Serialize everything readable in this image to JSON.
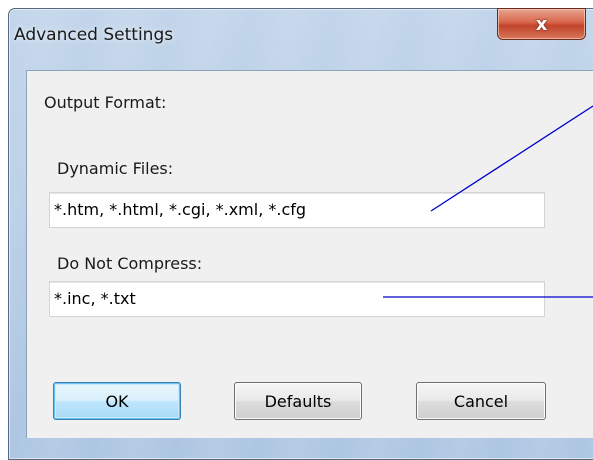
{
  "window": {
    "title": "Advanced Settings",
    "close_glyph": "x"
  },
  "dialog": {
    "output_format_label": "Output Format:",
    "dynamic_files_label": "Dynamic Files:",
    "dynamic_files_value": "*.htm, *.html, *.cgi, *.xml, *.cfg",
    "do_not_compress_label": "Do Not Compress:",
    "do_not_compress_value": "*.inc, *.txt"
  },
  "buttons": {
    "ok": "OK",
    "defaults": "Defaults",
    "cancel": "Cancel"
  },
  "colors": {
    "annotation_line": "#0000cc",
    "close_button": "#c1432a",
    "frame": "#b7cde6"
  }
}
